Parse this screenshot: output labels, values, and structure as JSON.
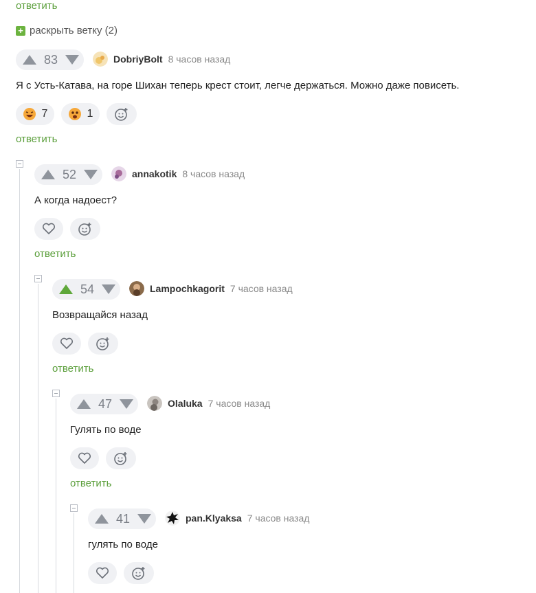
{
  "reply_label": "ответить",
  "expand_thread": {
    "label": "раскрыть ветку (2)",
    "icon": "plus-square-icon"
  },
  "colors": {
    "accent": "#5a9e3a",
    "upvoted": "#5fa83a",
    "pill_bg": "#f0f1f4"
  },
  "comments": [
    {
      "rating": "83",
      "upvoted": false,
      "author": "DobriyBolt",
      "time": "8 часов назад",
      "text": "Я с Усть-Катава, на горе Шихан теперь крест стоит, легче держаться. Можно даже повисеть.",
      "reactions": [
        {
          "icon": "laughing-emoji-icon",
          "count": "7"
        },
        {
          "icon": "scared-emoji-icon",
          "count": "1"
        }
      ]
    },
    {
      "rating": "52",
      "upvoted": false,
      "author": "annakotik",
      "time": "8 часов назад",
      "text": "А когда надоест?"
    },
    {
      "rating": "54",
      "upvoted": true,
      "author": "Lampochkagorit",
      "time": "7 часов назад",
      "text": "Возвращайся назад"
    },
    {
      "rating": "47",
      "upvoted": false,
      "author": "Olaluka",
      "time": "7 часов назад",
      "text": "Гулять по воде"
    },
    {
      "rating": "41",
      "upvoted": false,
      "author": "pan.Klyaksa",
      "time": "7 часов назад",
      "text": "гулять по воде"
    }
  ]
}
